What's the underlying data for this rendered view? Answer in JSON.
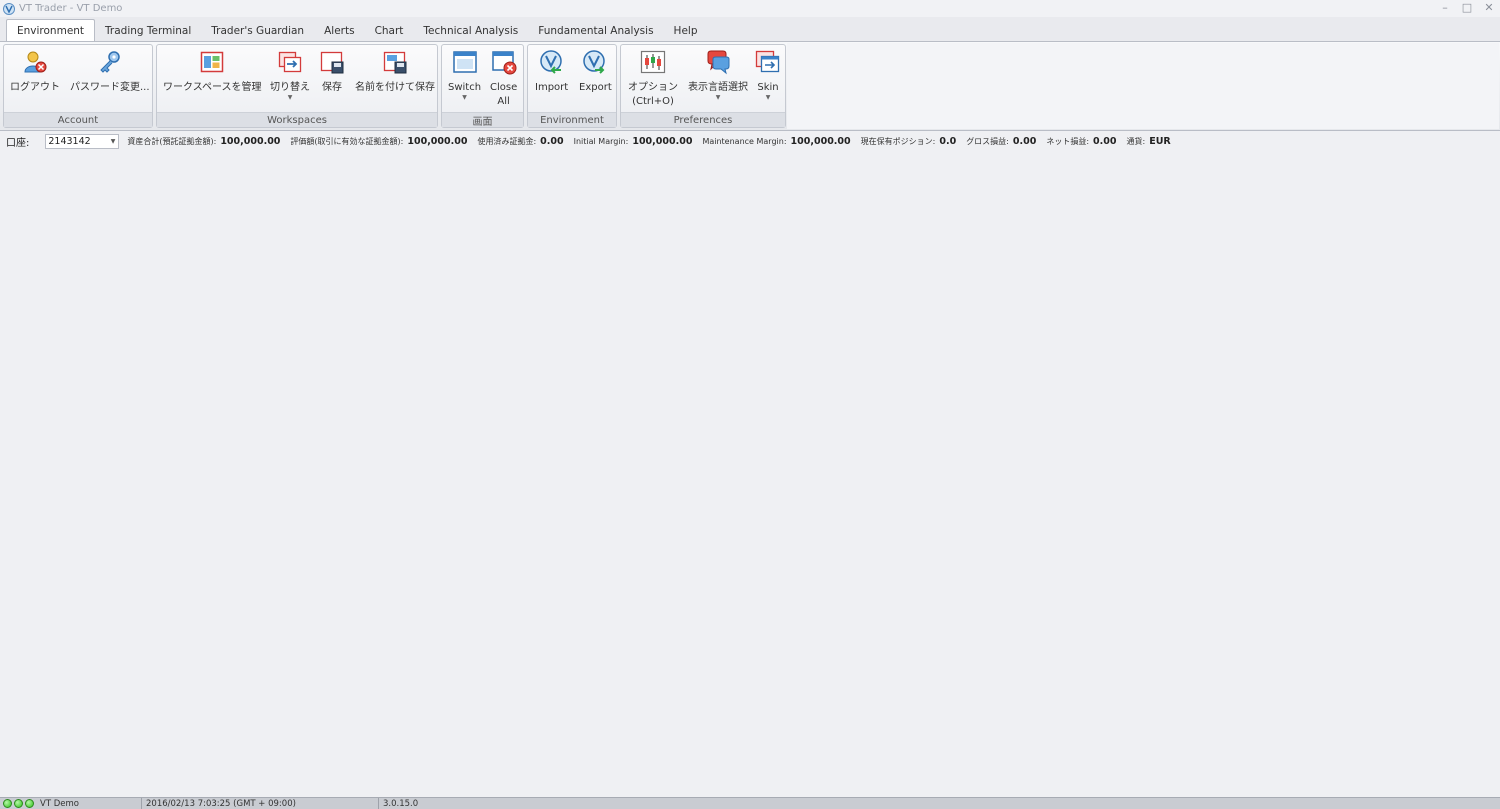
{
  "window": {
    "title": "VT Trader - VT Demo",
    "minimize": "–",
    "maximize": "□",
    "close": "✕"
  },
  "tabs": [
    {
      "label": "Environment",
      "active": true
    },
    {
      "label": "Trading Terminal"
    },
    {
      "label": "Trader's Guardian"
    },
    {
      "label": "Alerts"
    },
    {
      "label": "Chart"
    },
    {
      "label": "Technical Analysis"
    },
    {
      "label": "Fundamental Analysis"
    },
    {
      "label": "Help"
    }
  ],
  "ribbon": {
    "account": {
      "caption": "Account",
      "logout": "ログアウト",
      "change_password": "パスワード変更..."
    },
    "workspaces": {
      "caption": "Workspaces",
      "manage": "ワークスペースを管理",
      "switch": "切り替え",
      "save": "保存",
      "save_as": "名前を付けて保存"
    },
    "screen": {
      "caption": "画面",
      "switch": "Switch",
      "close_all_1": "Close",
      "close_all_2": "All"
    },
    "environment": {
      "caption": "Environment",
      "import": "Import",
      "export": "Export"
    },
    "preferences": {
      "caption": "Preferences",
      "options_1": "オプション",
      "options_2": "(Ctrl+O)",
      "language": "表示言語選択",
      "skin": "Skin"
    },
    "dropdown_arrow": "▼"
  },
  "account_bar": {
    "label": "口座:",
    "account_number": "2143142",
    "stats": [
      {
        "label": "資産合計(預託証拠金額):",
        "value": "100,000.00"
      },
      {
        "label": "評価額(取引に有効な証拠金額):",
        "value": "100,000.00"
      },
      {
        "label": "使用済み証拠金:",
        "value": "0.00"
      },
      {
        "label": "Initial Margin:",
        "value": "100,000.00"
      },
      {
        "label": "Maintenance Margin:",
        "value": "100,000.00"
      },
      {
        "label": "現在保有ポジション:",
        "value": "0.0"
      },
      {
        "label": "グロス損益:",
        "value": "0.00"
      },
      {
        "label": "ネット損益:",
        "value": "0.00"
      },
      {
        "label": "通貨:",
        "value": "EUR"
      }
    ]
  },
  "status_bar": {
    "connection": "VT Demo",
    "datetime": "2016/02/13 7:03:25 (GMT + 09:00)",
    "version": "3.0.15.0"
  },
  "colors": {
    "background": "#eff0f3",
    "ribbon": "#e6e8ec",
    "status_ok": "#2fc21a"
  }
}
